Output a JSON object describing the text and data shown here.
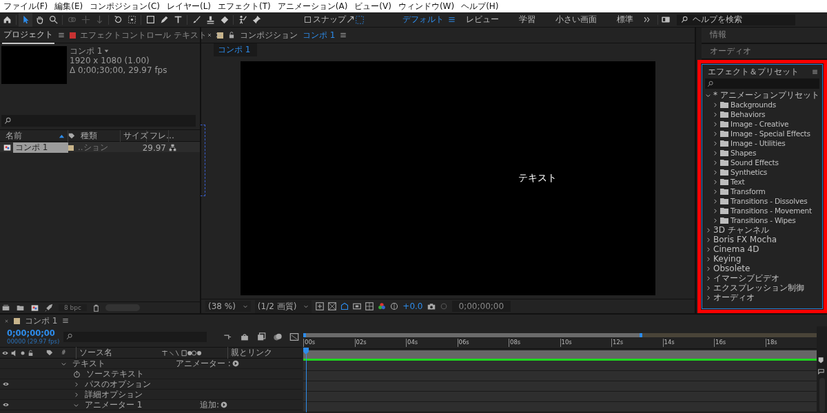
{
  "menu_bar": [
    "ファイル(F)",
    "編集(E)",
    "コンポジション(C)",
    "レイヤー(L)",
    "エフェクト(T)",
    "アニメーション(A)",
    "ビュー(V)",
    "ウィンドウ(W)",
    "ヘルプ(H)"
  ],
  "toolbar": {
    "tools": [
      {
        "kind": "home",
        "selected": false,
        "disabled": false
      },
      {
        "kind": "selection",
        "selected": true,
        "disabled": false
      },
      {
        "kind": "hand",
        "selected": false,
        "disabled": false
      },
      {
        "kind": "zoom",
        "selected": false,
        "disabled": false
      },
      {
        "kind": "orbit",
        "selected": false,
        "disabled": true
      },
      {
        "kind": "pan",
        "selected": false,
        "disabled": true
      },
      {
        "kind": "dolly",
        "selected": false,
        "disabled": true
      },
      {
        "kind": "rotate",
        "selected": false,
        "disabled": false
      },
      {
        "kind": "anchor",
        "selected": false,
        "disabled": false
      },
      {
        "kind": "rect",
        "selected": false,
        "disabled": false
      },
      {
        "kind": "pen",
        "selected": false,
        "disabled": false
      },
      {
        "kind": "type",
        "selected": false,
        "disabled": false
      },
      {
        "kind": "brush",
        "selected": false,
        "disabled": false
      },
      {
        "kind": "stamp",
        "selected": false,
        "disabled": false
      },
      {
        "kind": "eraser",
        "selected": false,
        "disabled": false
      },
      {
        "kind": "roto",
        "selected": false,
        "disabled": false
      },
      {
        "kind": "pin",
        "selected": false,
        "disabled": false
      }
    ],
    "snap": {
      "label": "スナップ",
      "checked": false
    },
    "workspaces": [
      {
        "label": "デフォルト",
        "selected": true
      },
      {
        "label": "レビュー",
        "selected": false
      },
      {
        "label": "学習",
        "selected": false
      },
      {
        "label": "小さい画面",
        "selected": false
      },
      {
        "label": "標準",
        "selected": false
      }
    ],
    "help_search": {
      "placeholder": "ヘルプを検索"
    }
  },
  "project_panel": {
    "tabs": [
      {
        "label": "プロジェクト",
        "selected": true
      },
      {
        "label": "エフェクトコントロール テキスト",
        "selected": false
      }
    ],
    "preview_info": {
      "name": "コンポ 1",
      "size": "1920 x 1080 (1.00)",
      "duration": "Δ 0;00;30;00, 29.97 fps"
    },
    "columns": [
      "名前",
      "種類",
      "サイズ",
      "フレ…"
    ],
    "rows": [
      {
        "name": "コンポ 1",
        "type": "..ション",
        "frame_rate": "29.97",
        "selected": true
      }
    ],
    "bit_depth": "8 bpc"
  },
  "composition_panel": {
    "tab_prefix": "コンポジション",
    "tab_comp": "コンポ 1",
    "breadcrumb": "コンポ 1",
    "canvas_text": "テキスト",
    "zoom": "(38 %)",
    "resolution": "(1/2 画質)",
    "exposure": "+0.0",
    "timecode": "0;00;00;00"
  },
  "right_panel": {
    "sections": [
      "情報",
      "オーディオ"
    ],
    "effects": {
      "title": "エフェクト＆プリセット",
      "tree": [
        {
          "label": "* アニメーションプリセット",
          "expanded": true,
          "children": [
            {
              "label": "Backgrounds",
              "expanded": false
            },
            {
              "label": "Behaviors",
              "expanded": false
            },
            {
              "label": "Image - Creative",
              "expanded": false
            },
            {
              "label": "Image - Special Effects",
              "expanded": false
            },
            {
              "label": "Image - Utilities",
              "expanded": false
            },
            {
              "label": "Shapes",
              "expanded": false
            },
            {
              "label": "Sound Effects",
              "expanded": false
            },
            {
              "label": "Synthetics",
              "expanded": false
            },
            {
              "label": "Text",
              "expanded": false
            },
            {
              "label": "Transform",
              "expanded": false
            },
            {
              "label": "Transitions - Dissolves",
              "expanded": false
            },
            {
              "label": "Transitions - Movement",
              "expanded": false
            },
            {
              "label": "Transitions - Wipes",
              "expanded": false
            }
          ]
        },
        {
          "label": "3D チャンネル",
          "expanded": false
        },
        {
          "label": "Boris FX Mocha",
          "expanded": false
        },
        {
          "label": "Cinema 4D",
          "expanded": false
        },
        {
          "label": "Keying",
          "expanded": false
        },
        {
          "label": "Obsolete",
          "expanded": false
        },
        {
          "label": "イマーシブビデオ",
          "expanded": false
        },
        {
          "label": "エクスプレッション制御",
          "expanded": false
        },
        {
          "label": "オーディオ",
          "expanded": false
        }
      ]
    }
  },
  "timeline": {
    "tab": "コンポ 1",
    "timecode": "0;00;00;00",
    "frame_info": "00000 (29.97 fps)",
    "columns": [
      "#",
      "ソース名",
      "親とリンク"
    ],
    "ruler": [
      "00s",
      "02s",
      "04s",
      "06s",
      "08s",
      "10s",
      "12s",
      "14s",
      "16s",
      "18s"
    ],
    "layers": [
      {
        "kind": "group",
        "label": "テキスト",
        "expanded": true,
        "visible": false,
        "action": "アニメーター :",
        "children": [
          {
            "kind": "property",
            "label": "ソーステキスト",
            "visible": false
          },
          {
            "kind": "group",
            "label": "パスのオプション",
            "expanded": false,
            "visible": true
          },
          {
            "kind": "group",
            "label": "詳細オプション",
            "expanded": false,
            "visible": false
          },
          {
            "kind": "group",
            "label": "アニメーター 1",
            "expanded": true,
            "visible": true,
            "action": "追加:"
          }
        ]
      }
    ]
  }
}
